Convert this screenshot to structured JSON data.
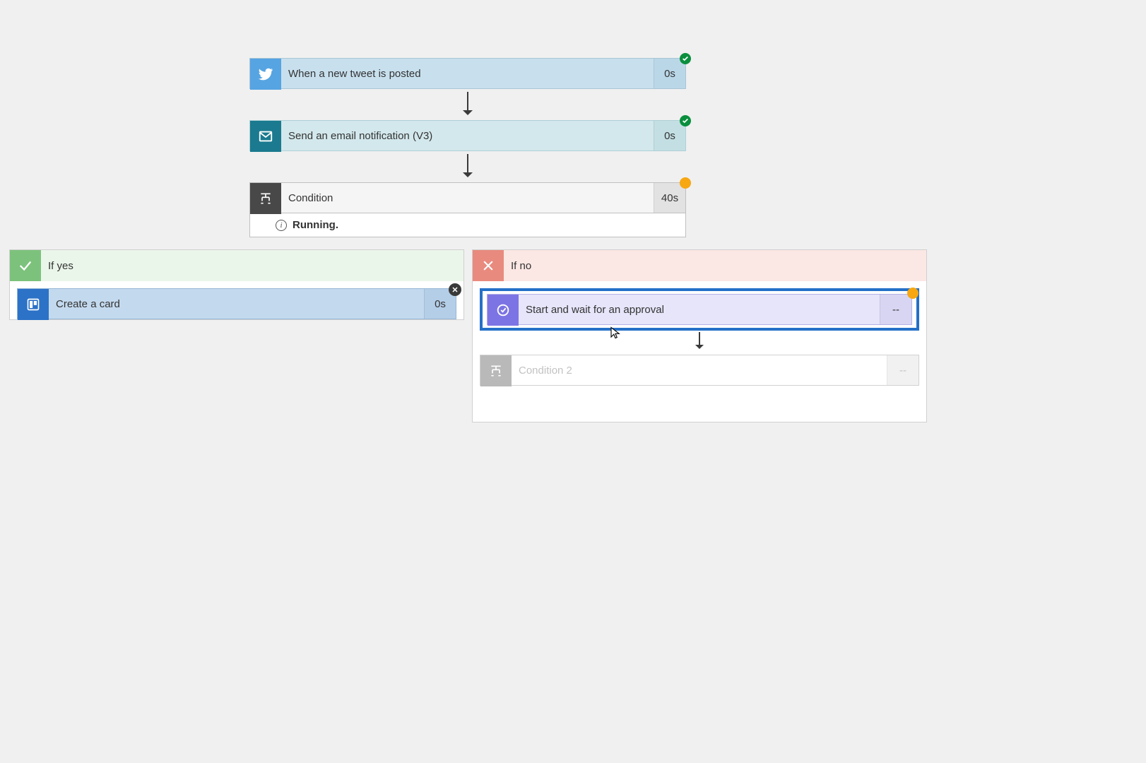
{
  "steps": {
    "twitter": {
      "label": "When a new tweet is posted",
      "duration": "0s"
    },
    "email": {
      "label": "Send an email notification (V3)",
      "duration": "0s"
    },
    "condition": {
      "label": "Condition",
      "duration": "40s",
      "status_label": "Running."
    }
  },
  "branches": {
    "yes": {
      "header": "If yes",
      "trello": {
        "label": "Create a card",
        "duration": "0s"
      }
    },
    "no": {
      "header": "If no",
      "approval": {
        "label": "Start and wait for an approval",
        "duration": "--"
      },
      "condition2": {
        "label": "Condition 2",
        "duration": "--"
      }
    }
  },
  "colors": {
    "success": "#0a8f3e",
    "warning": "#f7a711",
    "selection": "#2470c8"
  }
}
